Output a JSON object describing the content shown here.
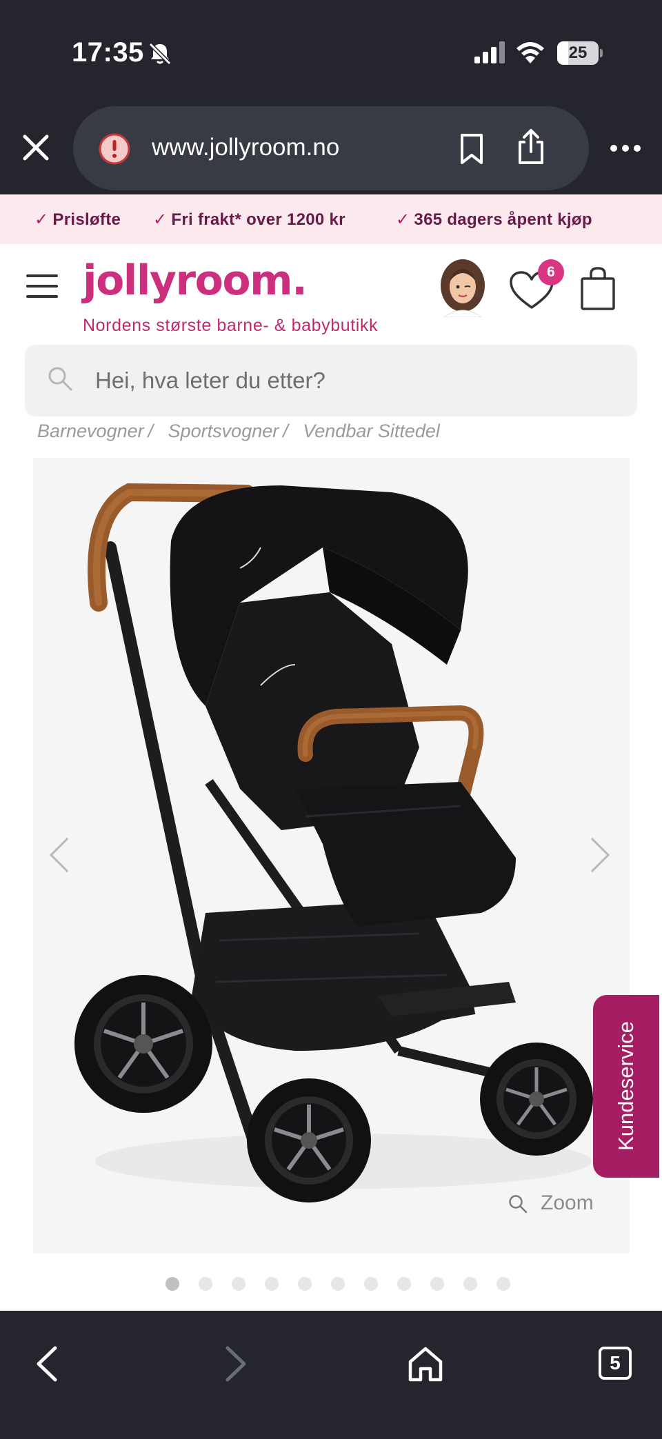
{
  "status_bar": {
    "time": "17:35",
    "battery": "25"
  },
  "browser": {
    "url": "www.jollyroom.no",
    "tab_count": "5"
  },
  "promo": {
    "items": [
      "Prisløfte",
      "Fri frakt* over 1200 kr",
      "365 dagers åpent kjøp"
    ]
  },
  "header": {
    "logo": "jollyroom.",
    "tagline": "Nordens største barne- & babybutikk",
    "wishlist_count": "6"
  },
  "search": {
    "placeholder": "Hei, hva leter du etter?"
  },
  "breadcrumb": {
    "items": [
      "Barnevogner",
      "Sportsvogner",
      "Vendbar Sittedel"
    ]
  },
  "product": {
    "zoom_label": "Zoom",
    "image_count": 11,
    "active_image": 1
  },
  "support": {
    "label": "Kundeservice"
  },
  "colors": {
    "brand": "#cc2f7d",
    "dark_bar": "#24252d",
    "promo_bg": "#fce9ee",
    "support_tab": "#a51e64"
  },
  "icons": [
    "bell-slash-icon",
    "signal-icon",
    "wifi-icon",
    "close-icon",
    "warning-icon",
    "bookmark-icon",
    "share-icon",
    "more-icon",
    "menu-icon",
    "avatar",
    "heart-icon",
    "bag-icon",
    "search-icon",
    "chevron-left-icon",
    "chevron-right-icon",
    "zoom-icon",
    "home-icon"
  ]
}
